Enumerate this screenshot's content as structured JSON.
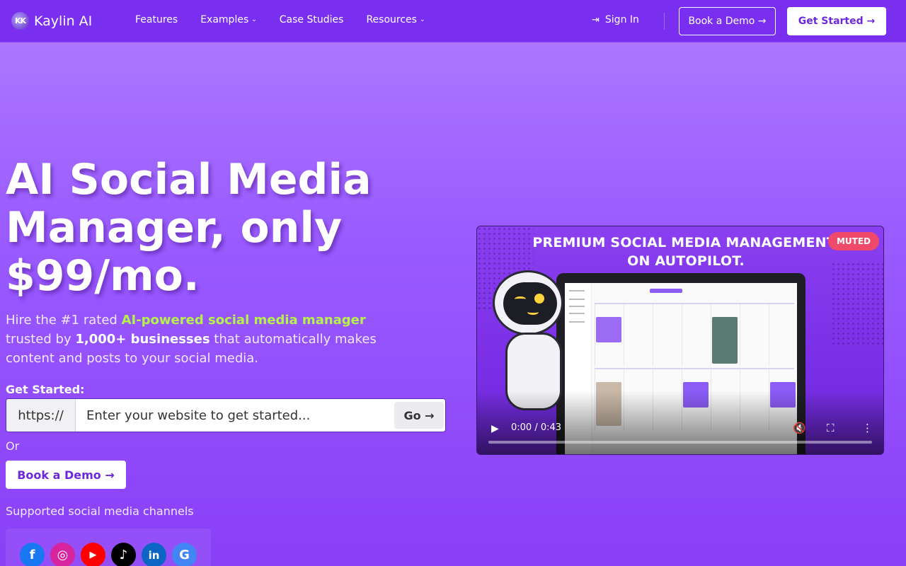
{
  "brand": {
    "name": "Kaylin AI",
    "logo_glyph": "KK"
  },
  "nav": {
    "links": [
      {
        "label": "Features",
        "has_dropdown": false
      },
      {
        "label": "Examples",
        "has_dropdown": true
      },
      {
        "label": "Case Studies",
        "has_dropdown": false
      },
      {
        "label": "Resources",
        "has_dropdown": true
      }
    ],
    "sign_in": "Sign In",
    "book_demo": "Book a Demo →",
    "get_started": "Get Started →"
  },
  "hero": {
    "headline": "AI Social Media Manager, only $99/mo.",
    "sub_pre": "Hire the #1 rated ",
    "sub_highlight": "AI-powered social media manager",
    "sub_mid": " trusted by ",
    "sub_bold": "1,000+ businesses",
    "sub_post": " that automatically makes content and posts to your social media.",
    "get_started_label": "Get Started:",
    "url_prefix": "https://",
    "url_placeholder": "Enter your website to get started...",
    "go_label": "Go →",
    "or_label": "Or",
    "book_demo": "Book a Demo →",
    "supported_label": "Supported social media channels"
  },
  "channels": [
    {
      "name": "facebook-icon",
      "color": "#1877f2",
      "glyph": "f"
    },
    {
      "name": "instagram-icon",
      "color": "#d6249f",
      "glyph": "◎"
    },
    {
      "name": "youtube-icon",
      "color": "#ff0000",
      "glyph": "▶"
    },
    {
      "name": "tiktok-icon",
      "color": "#000000",
      "glyph": "♪"
    },
    {
      "name": "linkedin-icon",
      "color": "#0a66c2",
      "glyph": "in"
    },
    {
      "name": "google-business-icon",
      "color": "#4285f4",
      "glyph": "G"
    }
  ],
  "video": {
    "title": "PREMIUM SOCIAL MEDIA MANAGEMENT, ON AUTOPILOT.",
    "muted_badge": "MUTED",
    "time": "0:00 / 0:43",
    "progress": 0
  },
  "colors": {
    "accent": "#6d28d9",
    "nav_bg": "#7a2ff0",
    "highlight": "#b6f24a",
    "muted_badge": "#ef4a6a"
  }
}
